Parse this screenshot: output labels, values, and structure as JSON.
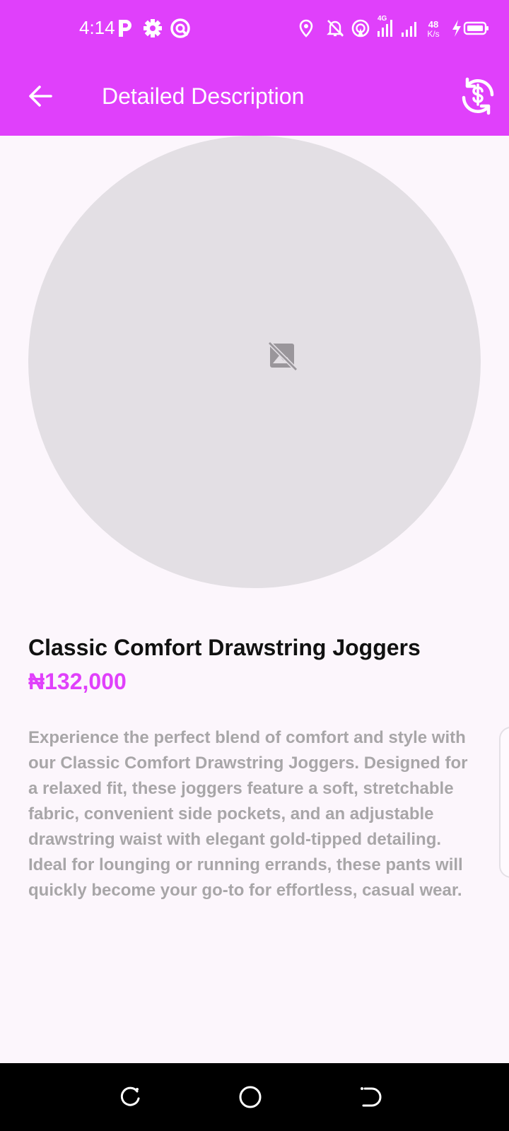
{
  "status_bar": {
    "time": "4:14",
    "left_icons": [
      "parking-icon",
      "settings-icon",
      "sync-app-icon"
    ],
    "right_icons": [
      "location-icon",
      "notifications-off-icon",
      "hotspot-icon",
      "signal-4g-icon",
      "signal-icon",
      "network-speed",
      "charging-icon",
      "battery-icon"
    ],
    "net_speed_value": "48",
    "net_speed_unit": "K/s",
    "network_type": "4G"
  },
  "app_bar": {
    "title": "Detailed Description",
    "background_color": "#e040fb",
    "back_icon": "arrow-back-icon",
    "action_icon": "currency-exchange-icon"
  },
  "product": {
    "image_placeholder_icon": "broken-image-icon",
    "name": "Classic Comfort Drawstring Joggers",
    "price": "₦132,000",
    "price_color": "#e040fb",
    "description": "Experience the perfect blend of comfort and style with our Classic Comfort Drawstring Joggers. Designed for a relaxed fit, these joggers feature a soft, stretchable fabric, convenient side pockets, and an adjustable drawstring waist with elegant gold-tipped detailing. Ideal for lounging or running errands, these pants will quickly become your go-to for effortless, casual wear."
  },
  "nav_bar": {
    "icons": [
      "recent-apps-icon",
      "home-icon",
      "back-nav-icon"
    ]
  }
}
